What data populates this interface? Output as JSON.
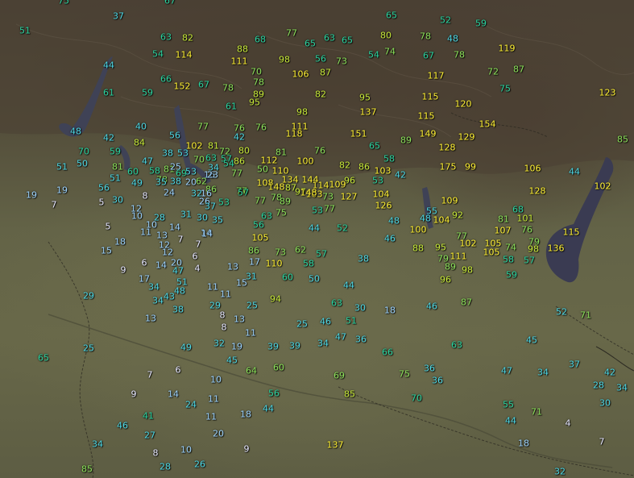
{
  "map": {
    "legend_colors": {
      "w": "#e8e8ff",
      "lb": "#9fd5ff",
      "c": "#4ed9e6",
      "g": "#2bd4a0",
      "lg": "#8de25b",
      "yg": "#c9ea3a",
      "y": "#fff135"
    },
    "labels": [
      {
        "v": "75",
        "c": "g"
      },
      {
        "v": "67",
        "c": "g"
      },
      {
        "v": "37",
        "c": "c"
      },
      {
        "v": "65",
        "c": "g"
      },
      {
        "v": "52",
        "c": "g"
      },
      {
        "v": "59",
        "c": "g"
      },
      {
        "v": "51",
        "c": "g"
      },
      {
        "v": "63",
        "c": "g"
      },
      {
        "v": "82",
        "c": "yg"
      },
      {
        "v": "68",
        "c": "g"
      },
      {
        "v": "77",
        "c": "lg"
      },
      {
        "v": "65",
        "c": "g"
      },
      {
        "v": "63",
        "c": "g"
      },
      {
        "v": "65",
        "c": "g"
      },
      {
        "v": "80",
        "c": "yg"
      },
      {
        "v": "78",
        "c": "lg"
      },
      {
        "v": "48",
        "c": "c"
      },
      {
        "v": "54",
        "c": "g"
      },
      {
        "v": "114",
        "c": "y"
      },
      {
        "v": "88",
        "c": "yg"
      },
      {
        "v": "98",
        "c": "yg"
      },
      {
        "v": "56",
        "c": "g"
      },
      {
        "v": "73",
        "c": "lg"
      },
      {
        "v": "54",
        "c": "g"
      },
      {
        "v": "74",
        "c": "lg"
      },
      {
        "v": "67",
        "c": "g"
      },
      {
        "v": "78",
        "c": "lg"
      },
      {
        "v": "119",
        "c": "y"
      },
      {
        "v": "44",
        "c": "c"
      },
      {
        "v": "111",
        "c": "y"
      },
      {
        "v": "70",
        "c": "lg"
      },
      {
        "v": "106",
        "c": "y"
      },
      {
        "v": "87",
        "c": "yg"
      },
      {
        "v": "72",
        "c": "lg"
      },
      {
        "v": "87",
        "c": "lg"
      },
      {
        "v": "117",
        "c": "y"
      },
      {
        "v": "66",
        "c": "g"
      },
      {
        "v": "152",
        "c": "y"
      },
      {
        "v": "67",
        "c": "g"
      },
      {
        "v": "78",
        "c": "lg"
      },
      {
        "v": "78",
        "c": "lg"
      },
      {
        "v": "75",
        "c": "g"
      },
      {
        "v": "61",
        "c": "g"
      },
      {
        "v": "59",
        "c": "g"
      },
      {
        "v": "89",
        "c": "yg"
      },
      {
        "v": "82",
        "c": "yg"
      },
      {
        "v": "95",
        "c": "yg"
      },
      {
        "v": "115",
        "c": "y"
      },
      {
        "v": "123",
        "c": "y"
      },
      {
        "v": "95",
        "c": "yg"
      },
      {
        "v": "61",
        "c": "g"
      },
      {
        "v": "98",
        "c": "yg"
      },
      {
        "v": "137",
        "c": "y"
      },
      {
        "v": "120",
        "c": "y"
      },
      {
        "v": "115",
        "c": "y"
      },
      {
        "v": "40",
        "c": "c"
      },
      {
        "v": "77",
        "c": "lg"
      },
      {
        "v": "76",
        "c": "lg"
      },
      {
        "v": "76",
        "c": "lg"
      },
      {
        "v": "111",
        "c": "y"
      },
      {
        "v": "154",
        "c": "y"
      },
      {
        "v": "48",
        "c": "c"
      },
      {
        "v": "42",
        "c": "c"
      },
      {
        "v": "56",
        "c": "c"
      },
      {
        "v": "42",
        "c": "c"
      },
      {
        "v": "118",
        "c": "y"
      },
      {
        "v": "151",
        "c": "y"
      },
      {
        "v": "149",
        "c": "y"
      },
      {
        "v": "129",
        "c": "y"
      },
      {
        "v": "89",
        "c": "lg"
      },
      {
        "v": "85",
        "c": "lg"
      },
      {
        "v": "84",
        "c": "yg"
      },
      {
        "v": "102",
        "c": "y"
      },
      {
        "v": "81",
        "c": "yg"
      },
      {
        "v": "65",
        "c": "g"
      },
      {
        "v": "128",
        "c": "y"
      },
      {
        "v": "70",
        "c": "g"
      },
      {
        "v": "59",
        "c": "g"
      },
      {
        "v": "38",
        "c": "c"
      },
      {
        "v": "53",
        "c": "c"
      },
      {
        "v": "72",
        "c": "lg"
      },
      {
        "v": "80",
        "c": "yg"
      },
      {
        "v": "81",
        "c": "lg"
      },
      {
        "v": "76",
        "c": "lg"
      },
      {
        "v": "50",
        "c": "c"
      },
      {
        "v": "47",
        "c": "c"
      },
      {
        "v": "70",
        "c": "lg"
      },
      {
        "v": "63",
        "c": "g"
      },
      {
        "v": "57",
        "c": "g"
      },
      {
        "v": "86",
        "c": "yg"
      },
      {
        "v": "112",
        "c": "y"
      },
      {
        "v": "100",
        "c": "y"
      },
      {
        "v": "58",
        "c": "g"
      },
      {
        "v": "51",
        "c": "c"
      },
      {
        "v": "81",
        "c": "lg"
      },
      {
        "v": "58",
        "c": "g"
      },
      {
        "v": "81",
        "c": "lg"
      },
      {
        "v": "25",
        "c": "lb"
      },
      {
        "v": "34",
        "c": "c"
      },
      {
        "v": "54",
        "c": "g"
      },
      {
        "v": "50",
        "c": "lg"
      },
      {
        "v": "110",
        "c": "y"
      },
      {
        "v": "82",
        "c": "yg"
      },
      {
        "v": "86",
        "c": "yg"
      },
      {
        "v": "103",
        "c": "y"
      },
      {
        "v": "175",
        "c": "y"
      },
      {
        "v": "99",
        "c": "y"
      },
      {
        "v": "106",
        "c": "y"
      },
      {
        "v": "44",
        "c": "c"
      },
      {
        "v": "51",
        "c": "c"
      },
      {
        "v": "60",
        "c": "g"
      },
      {
        "v": "78",
        "c": "lg"
      },
      {
        "v": "69",
        "c": "g"
      },
      {
        "v": "53",
        "c": "c"
      },
      {
        "v": "16",
        "c": "lb"
      },
      {
        "v": "23",
        "c": "lb"
      },
      {
        "v": "77",
        "c": "lg"
      },
      {
        "v": "134",
        "c": "y"
      },
      {
        "v": "144",
        "c": "y"
      },
      {
        "v": "114",
        "c": "y"
      },
      {
        "v": "96",
        "c": "yg"
      },
      {
        "v": "53",
        "c": "g"
      },
      {
        "v": "42",
        "c": "c"
      },
      {
        "v": "56",
        "c": "c"
      },
      {
        "v": "49",
        "c": "c"
      },
      {
        "v": "38",
        "c": "c"
      },
      {
        "v": "35",
        "c": "c"
      },
      {
        "v": "20",
        "c": "lb"
      },
      {
        "v": "62",
        "c": "lg"
      },
      {
        "v": "86",
        "c": "lg"
      },
      {
        "v": "76",
        "c": "lg"
      },
      {
        "v": "77",
        "c": "lg"
      },
      {
        "v": "108",
        "c": "y"
      },
      {
        "v": "148",
        "c": "y"
      },
      {
        "v": "87",
        "c": "yg"
      },
      {
        "v": "97",
        "c": "yg"
      },
      {
        "v": "103",
        "c": "y"
      },
      {
        "v": "109",
        "c": "y"
      },
      {
        "v": "128",
        "c": "y"
      },
      {
        "v": "102",
        "c": "y"
      },
      {
        "v": "19",
        "c": "lb"
      },
      {
        "v": "19",
        "c": "lb"
      },
      {
        "v": "30",
        "c": "c"
      },
      {
        "v": "8",
        "c": "w"
      },
      {
        "v": "24",
        "c": "lb"
      },
      {
        "v": "32",
        "c": "c"
      },
      {
        "v": "16",
        "c": "lb"
      },
      {
        "v": "57",
        "c": "g"
      },
      {
        "v": "77",
        "c": "lg"
      },
      {
        "v": "78",
        "c": "lg"
      },
      {
        "v": "89",
        "c": "lg"
      },
      {
        "v": "148",
        "c": "y"
      },
      {
        "v": "73",
        "c": "lg"
      },
      {
        "v": "127",
        "c": "y"
      },
      {
        "v": "104",
        "c": "y"
      },
      {
        "v": "7",
        "c": "w"
      },
      {
        "v": "5",
        "c": "w"
      },
      {
        "v": "12",
        "c": "lb"
      },
      {
        "v": "26",
        "c": "lb"
      },
      {
        "v": "37",
        "c": "c"
      },
      {
        "v": "53",
        "c": "g"
      },
      {
        "v": "75",
        "c": "lg"
      },
      {
        "v": "53",
        "c": "g"
      },
      {
        "v": "77",
        "c": "lg"
      },
      {
        "v": "126",
        "c": "y"
      },
      {
        "v": "55",
        "c": "c"
      },
      {
        "v": "109",
        "c": "y"
      },
      {
        "v": "10",
        "c": "lb"
      },
      {
        "v": "28",
        "c": "c"
      },
      {
        "v": "31",
        "c": "c"
      },
      {
        "v": "30",
        "c": "c"
      },
      {
        "v": "35",
        "c": "c"
      },
      {
        "v": "63",
        "c": "g"
      },
      {
        "v": "48",
        "c": "c"
      },
      {
        "v": "48",
        "c": "c"
      },
      {
        "v": "104",
        "c": "y"
      },
      {
        "v": "92",
        "c": "yg"
      },
      {
        "v": "68",
        "c": "g"
      },
      {
        "v": "5",
        "c": "w"
      },
      {
        "v": "10",
        "c": "lb"
      },
      {
        "v": "14",
        "c": "lb"
      },
      {
        "v": "14",
        "c": "lb"
      },
      {
        "v": "56",
        "c": "g"
      },
      {
        "v": "44",
        "c": "c"
      },
      {
        "v": "52",
        "c": "g"
      },
      {
        "v": "100",
        "c": "y"
      },
      {
        "v": "81",
        "c": "lg"
      },
      {
        "v": "101",
        "c": "yg"
      },
      {
        "v": "11",
        "c": "lb"
      },
      {
        "v": "13",
        "c": "lb"
      },
      {
        "v": "105",
        "c": "y"
      },
      {
        "v": "46",
        "c": "c"
      },
      {
        "v": "77",
        "c": "lg"
      },
      {
        "v": "107",
        "c": "y"
      },
      {
        "v": "76",
        "c": "lg"
      },
      {
        "v": "115",
        "c": "y"
      },
      {
        "v": "18",
        "c": "lb"
      },
      {
        "v": "12",
        "c": "lb"
      },
      {
        "v": "7",
        "c": "w"
      },
      {
        "v": "7",
        "c": "w"
      },
      {
        "v": "14",
        "c": "lb"
      },
      {
        "v": "102",
        "c": "y"
      },
      {
        "v": "105",
        "c": "y"
      },
      {
        "v": "79",
        "c": "lg"
      },
      {
        "v": "15",
        "c": "lb"
      },
      {
        "v": "12",
        "c": "lb"
      },
      {
        "v": "86",
        "c": "lg"
      },
      {
        "v": "73",
        "c": "lg"
      },
      {
        "v": "62",
        "c": "lg"
      },
      {
        "v": "57",
        "c": "g"
      },
      {
        "v": "88",
        "c": "yg"
      },
      {
        "v": "95",
        "c": "yg"
      },
      {
        "v": "74",
        "c": "lg"
      },
      {
        "v": "98",
        "c": "yg"
      },
      {
        "v": "136",
        "c": "y"
      },
      {
        "v": "6",
        "c": "w"
      },
      {
        "v": "20",
        "c": "lb"
      },
      {
        "v": "6",
        "c": "w"
      },
      {
        "v": "17",
        "c": "lb"
      },
      {
        "v": "110",
        "c": "y"
      },
      {
        "v": "58",
        "c": "g"
      },
      {
        "v": "38",
        "c": "c"
      },
      {
        "v": "79",
        "c": "lg"
      },
      {
        "v": "111",
        "c": "y"
      },
      {
        "v": "105",
        "c": "y"
      },
      {
        "v": "58",
        "c": "g"
      },
      {
        "v": "57",
        "c": "g"
      },
      {
        "v": "9",
        "c": "w"
      },
      {
        "v": "14",
        "c": "lb"
      },
      {
        "v": "47",
        "c": "c"
      },
      {
        "v": "4",
        "c": "w"
      },
      {
        "v": "13",
        "c": "lb"
      },
      {
        "v": "89",
        "c": "lg"
      },
      {
        "v": "98",
        "c": "yg"
      },
      {
        "v": "17",
        "c": "lb"
      },
      {
        "v": "51",
        "c": "c"
      },
      {
        "v": "31",
        "c": "c"
      },
      {
        "v": "60",
        "c": "g"
      },
      {
        "v": "50",
        "c": "c"
      },
      {
        "v": "96",
        "c": "yg"
      },
      {
        "v": "59",
        "c": "g"
      },
      {
        "v": "34",
        "c": "c"
      },
      {
        "v": "48",
        "c": "c"
      },
      {
        "v": "11",
        "c": "lb"
      },
      {
        "v": "15",
        "c": "lb"
      },
      {
        "v": "44",
        "c": "c"
      },
      {
        "v": "29",
        "c": "c"
      },
      {
        "v": "34",
        "c": "c"
      },
      {
        "v": "43",
        "c": "c"
      },
      {
        "v": "11",
        "c": "lb"
      },
      {
        "v": "94",
        "c": "yg"
      },
      {
        "v": "63",
        "c": "g"
      },
      {
        "v": "46",
        "c": "c"
      },
      {
        "v": "87",
        "c": "lg"
      },
      {
        "v": "38",
        "c": "c"
      },
      {
        "v": "29",
        "c": "c"
      },
      {
        "v": "25",
        "c": "c"
      },
      {
        "v": "30",
        "c": "c"
      },
      {
        "v": "18",
        "c": "lb"
      },
      {
        "v": "52",
        "c": "c"
      },
      {
        "v": "71",
        "c": "lg"
      },
      {
        "v": "13",
        "c": "lb"
      },
      {
        "v": "8",
        "c": "w"
      },
      {
        "v": "13",
        "c": "lb"
      },
      {
        "v": "51",
        "c": "g"
      },
      {
        "v": "8",
        "c": "w"
      },
      {
        "v": "11",
        "c": "lb"
      },
      {
        "v": "25",
        "c": "c"
      },
      {
        "v": "46",
        "c": "c"
      },
      {
        "v": "47",
        "c": "c"
      },
      {
        "v": "36",
        "c": "c"
      },
      {
        "v": "39",
        "c": "c"
      },
      {
        "v": "32",
        "c": "c"
      },
      {
        "v": "34",
        "c": "c"
      },
      {
        "v": "63",
        "c": "g"
      },
      {
        "v": "25",
        "c": "c"
      },
      {
        "v": "49",
        "c": "c"
      },
      {
        "v": "19",
        "c": "lb"
      },
      {
        "v": "39",
        "c": "c"
      },
      {
        "v": "66",
        "c": "g"
      },
      {
        "v": "65",
        "c": "g"
      },
      {
        "v": "45",
        "c": "c"
      },
      {
        "v": "45",
        "c": "c"
      },
      {
        "v": "64",
        "c": "lg"
      },
      {
        "v": "60",
        "c": "lg"
      },
      {
        "v": "36",
        "c": "c"
      },
      {
        "v": "47",
        "c": "c"
      },
      {
        "v": "34",
        "c": "c"
      },
      {
        "v": "37",
        "c": "c"
      },
      {
        "v": "7",
        "c": "w"
      },
      {
        "v": "6",
        "c": "w"
      },
      {
        "v": "10",
        "c": "lb"
      },
      {
        "v": "69",
        "c": "lg"
      },
      {
        "v": "75",
        "c": "lg"
      },
      {
        "v": "36",
        "c": "c"
      },
      {
        "v": "9",
        "c": "w"
      },
      {
        "v": "14",
        "c": "lb"
      },
      {
        "v": "56",
        "c": "g"
      },
      {
        "v": "85",
        "c": "yg"
      },
      {
        "v": "70",
        "c": "g"
      },
      {
        "v": "42",
        "c": "c"
      },
      {
        "v": "28",
        "c": "c"
      },
      {
        "v": "34",
        "c": "c"
      },
      {
        "v": "11",
        "c": "lb"
      },
      {
        "v": "24",
        "c": "c"
      },
      {
        "v": "44",
        "c": "c"
      },
      {
        "v": "55",
        "c": "g"
      },
      {
        "v": "30",
        "c": "c"
      },
      {
        "v": "41",
        "c": "g"
      },
      {
        "v": "11",
        "c": "lb"
      },
      {
        "v": "18",
        "c": "lb"
      },
      {
        "v": "71",
        "c": "lg"
      },
      {
        "v": "46",
        "c": "c"
      },
      {
        "v": "44",
        "c": "c"
      },
      {
        "v": "4",
        "c": "w"
      },
      {
        "v": "27",
        "c": "c"
      },
      {
        "v": "20",
        "c": "lb"
      },
      {
        "v": "34",
        "c": "c"
      },
      {
        "v": "137",
        "c": "y"
      },
      {
        "v": "18",
        "c": "lb"
      },
      {
        "v": "7",
        "c": "w"
      },
      {
        "v": "8",
        "c": "w"
      },
      {
        "v": "10",
        "c": "lb"
      },
      {
        "v": "9",
        "c": "w"
      },
      {
        "v": "85",
        "c": "lg"
      },
      {
        "v": "28",
        "c": "c"
      },
      {
        "v": "26",
        "c": "c"
      },
      {
        "v": "32",
        "c": "c"
      }
    ]
  }
}
